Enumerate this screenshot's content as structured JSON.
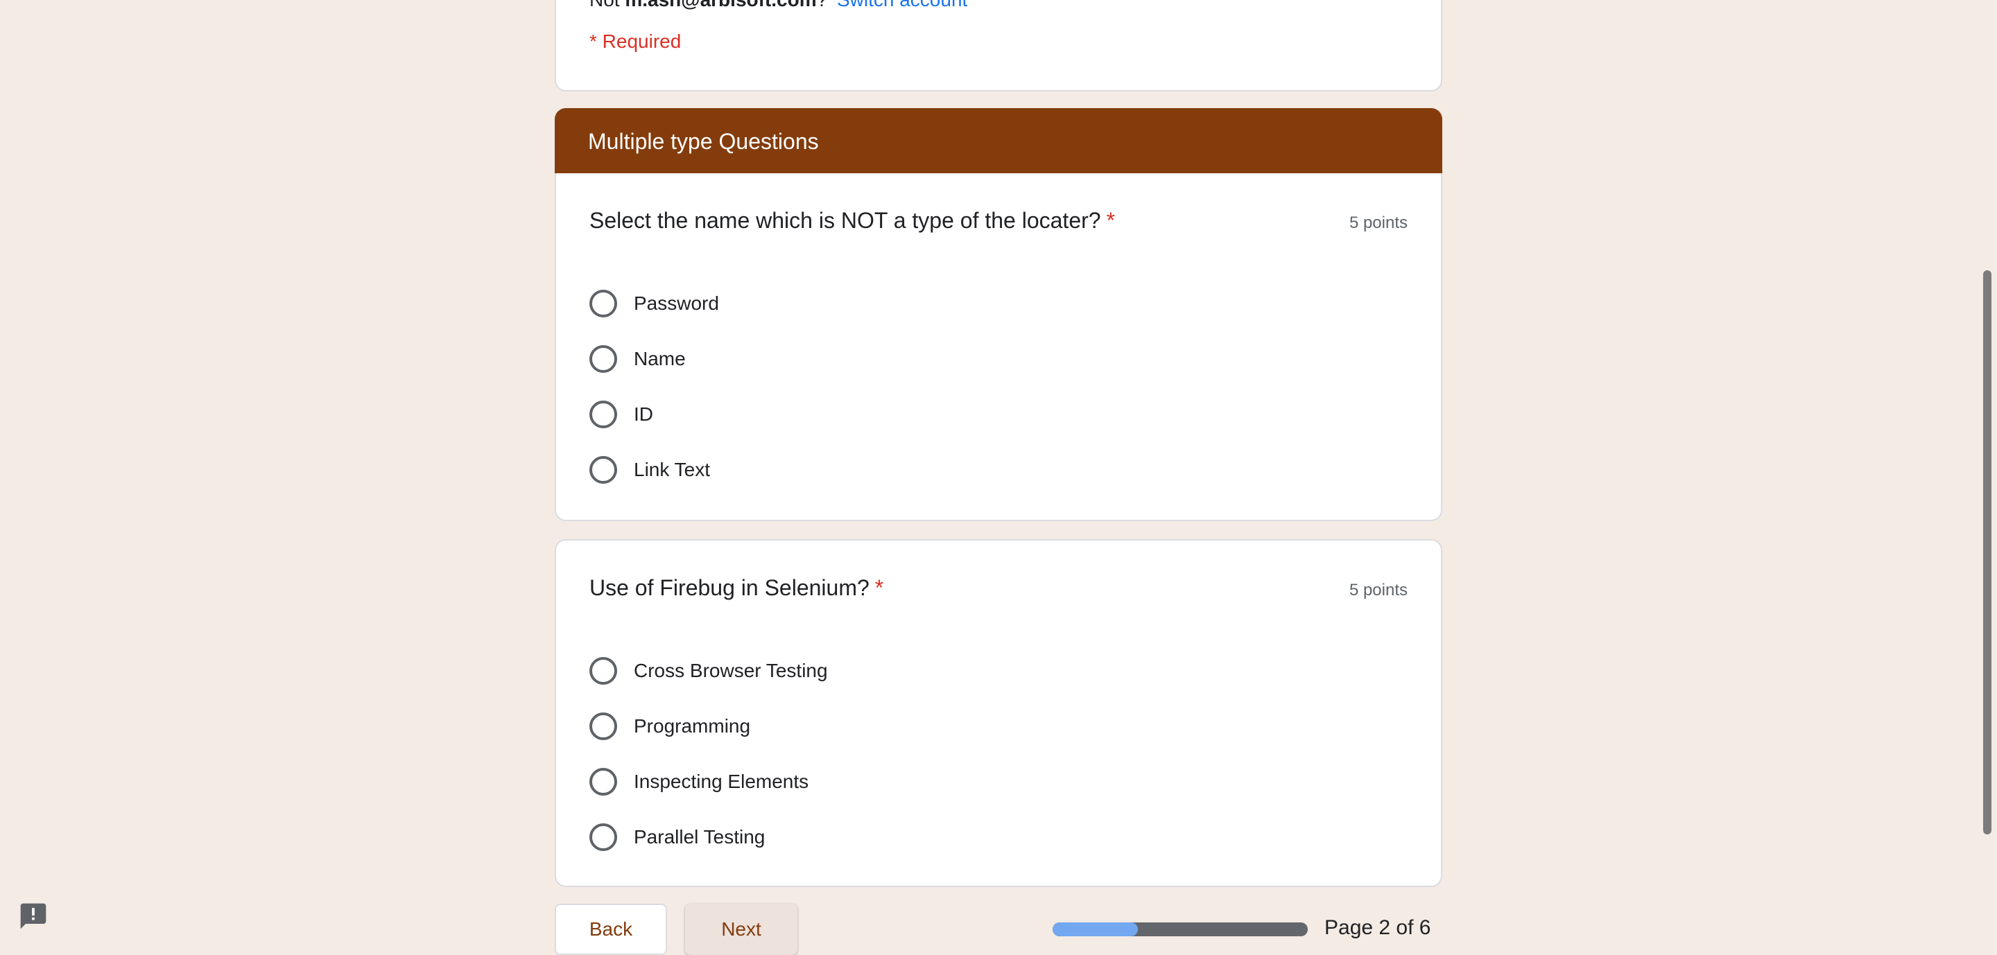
{
  "account": {
    "prefix": "Not",
    "email": "m.ash@arbisoft.com",
    "suffix": "?",
    "switch_label": "Switch account"
  },
  "required_note": "* Required",
  "section": {
    "title": "Multiple type Questions"
  },
  "questions": [
    {
      "title": "Select the name which is NOT a type of the locater?",
      "required_mark": "*",
      "points": "5 points",
      "options": [
        "Password",
        "Name",
        "ID",
        "Link Text"
      ]
    },
    {
      "title": "Use of Firebug in Selenium?",
      "required_mark": "*",
      "points": "5 points",
      "options": [
        "Cross Browser Testing",
        "Programming",
        "Inspecting Elements",
        "Parallel Testing"
      ]
    }
  ],
  "nav": {
    "back_label": "Back",
    "next_label": "Next",
    "page_indicator": "Page 2 of 6",
    "progress_fraction": 0.333
  },
  "colors": {
    "theme": "#843c0c",
    "background": "#f4ebe5",
    "required": "#d93025",
    "link": "#1a73e8",
    "progress_fill": "#73a7ef",
    "progress_track": "#63666a"
  },
  "icons": {
    "feedback": "feedback-icon"
  }
}
